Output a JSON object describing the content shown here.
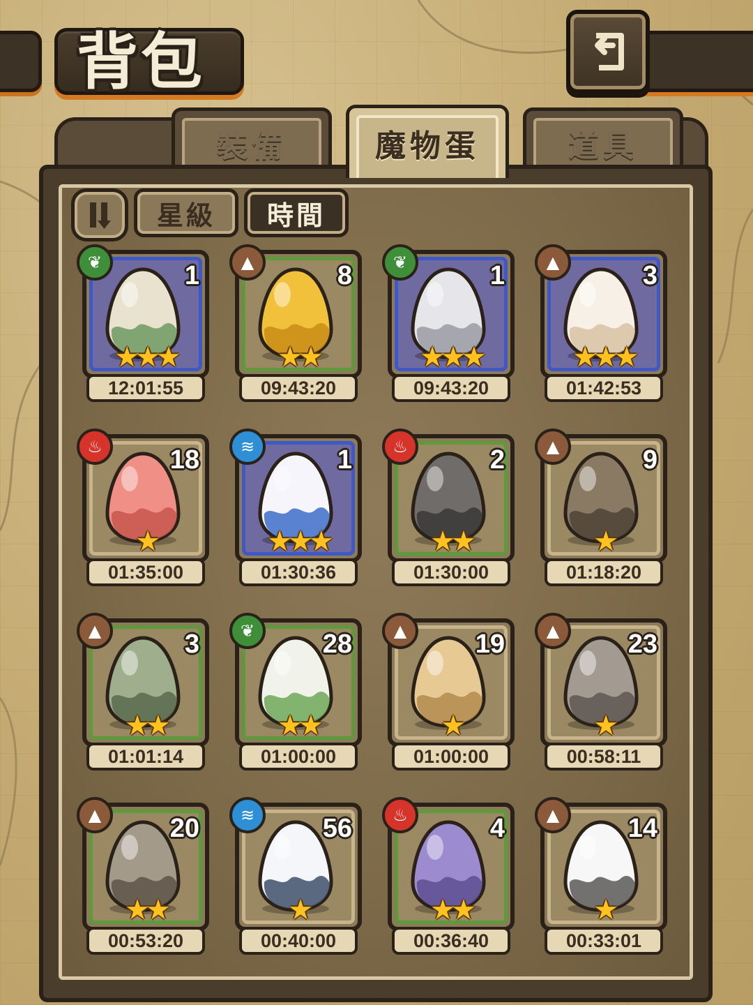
{
  "header": {
    "title": "背包",
    "back_icon": "back-arrow-icon"
  },
  "tabs": [
    {
      "label": "裝備",
      "active": false
    },
    {
      "label": "魔物蛋",
      "active": true
    },
    {
      "label": "道具",
      "active": false
    }
  ],
  "sort": {
    "toggle_icon": "sort-order-icon",
    "options": [
      {
        "label": "星級",
        "active": false
      },
      {
        "label": "時間",
        "active": true
      }
    ]
  },
  "element_colors": {
    "nature": "#3f8f3a",
    "earth": "#8a5a3a",
    "fire": "#d6332a",
    "water": "#2f8fd6"
  },
  "eggs": [
    {
      "count": "1",
      "stars": 3,
      "timer": "12:01:55",
      "element": "nature",
      "rarity": "blue",
      "egg_icon": "leaf-wrapped-egg-icon"
    },
    {
      "count": "8",
      "stars": 2,
      "timer": "09:43:20",
      "element": "earth",
      "rarity": "green",
      "egg_icon": "golden-slime-egg-icon"
    },
    {
      "count": "1",
      "stars": 3,
      "timer": "09:43:20",
      "element": "nature",
      "rarity": "blue",
      "egg_icon": "rainbow-gem-egg-icon"
    },
    {
      "count": "3",
      "stars": 3,
      "timer": "01:42:53",
      "element": "earth",
      "rarity": "blue",
      "egg_icon": "fluffy-creature-egg-icon"
    },
    {
      "count": "18",
      "stars": 1,
      "timer": "01:35:00",
      "element": "fire",
      "rarity": "plain",
      "egg_icon": "pink-slime-egg-icon"
    },
    {
      "count": "1",
      "stars": 3,
      "timer": "01:30:36",
      "element": "water",
      "rarity": "blue",
      "egg_icon": "sailor-bow-egg-icon"
    },
    {
      "count": "2",
      "stars": 2,
      "timer": "01:30:00",
      "element": "fire",
      "rarity": "green",
      "egg_icon": "rock-golem-egg-icon"
    },
    {
      "count": "9",
      "stars": 1,
      "timer": "01:18:20",
      "element": "earth",
      "rarity": "plain",
      "egg_icon": "helmet-egg-icon"
    },
    {
      "count": "3",
      "stars": 2,
      "timer": "01:01:14",
      "element": "earth",
      "rarity": "green",
      "egg_icon": "seed-pod-egg-icon"
    },
    {
      "count": "28",
      "stars": 2,
      "timer": "01:00:00",
      "element": "nature",
      "rarity": "green",
      "egg_icon": "turnip-egg-icon"
    },
    {
      "count": "19",
      "stars": 1,
      "timer": "01:00:00",
      "element": "earth",
      "rarity": "plain",
      "egg_icon": "sand-slime-egg-icon"
    },
    {
      "count": "23",
      "stars": 1,
      "timer": "00:58:11",
      "element": "earth",
      "rarity": "plain",
      "egg_icon": "cracked-stone-egg-icon"
    },
    {
      "count": "20",
      "stars": 2,
      "timer": "00:53:20",
      "element": "earth",
      "rarity": "green",
      "egg_icon": "stone-golem-egg-icon"
    },
    {
      "count": "56",
      "stars": 1,
      "timer": "00:40:00",
      "element": "water",
      "rarity": "plain",
      "egg_icon": "striped-white-egg-icon"
    },
    {
      "count": "4",
      "stars": 2,
      "timer": "00:36:40",
      "element": "fire",
      "rarity": "green",
      "egg_icon": "purple-flower-egg-icon"
    },
    {
      "count": "14",
      "stars": 1,
      "timer": "00:33:01",
      "element": "earth",
      "rarity": "plain",
      "egg_icon": "penguin-egg-icon"
    }
  ]
}
